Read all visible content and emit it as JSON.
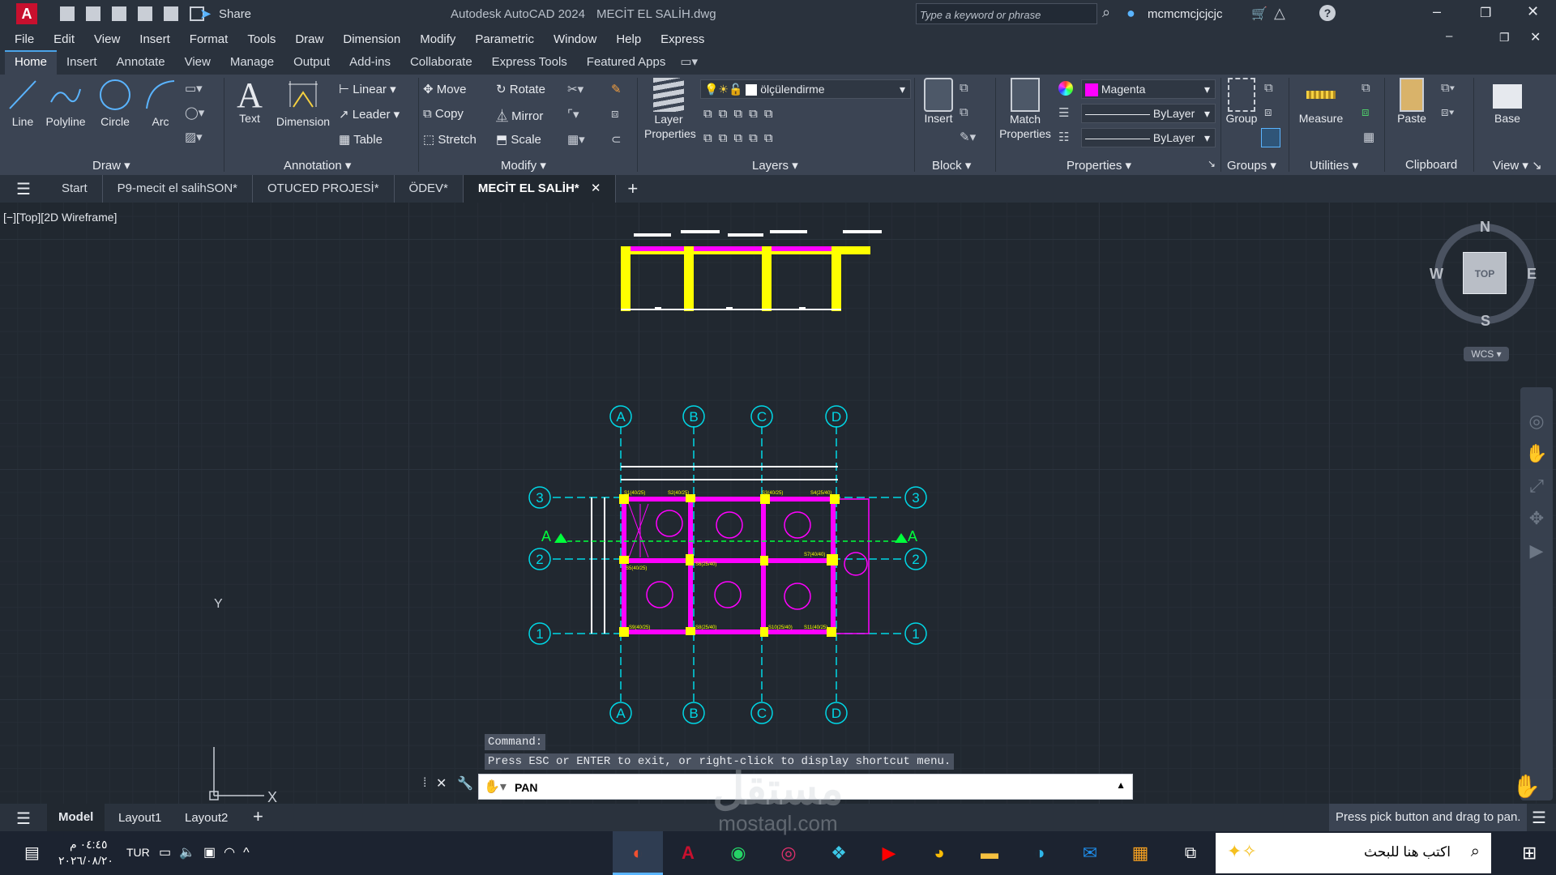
{
  "window": {
    "title": "Autodesk AutoCAD 2024",
    "file": "MECİT EL SALİH.dwg",
    "share": "Share",
    "search_placeholder": "Type a keyword or phrase",
    "user": "mcmcmcjcjcjc"
  },
  "menu": [
    "File",
    "Edit",
    "View",
    "Insert",
    "Format",
    "Tools",
    "Draw",
    "Dimension",
    "Modify",
    "Parametric",
    "Window",
    "Help",
    "Express"
  ],
  "ribbon_tabs": [
    "Home",
    "Insert",
    "Annotate",
    "View",
    "Manage",
    "Output",
    "Add-ins",
    "Collaborate",
    "Express Tools",
    "Featured Apps"
  ],
  "ribbon": {
    "draw": {
      "title": "Draw",
      "line": "Line",
      "polyline": "Polyline",
      "circle": "Circle",
      "arc": "Arc"
    },
    "annotation": {
      "title": "Annotation",
      "text": "Text",
      "dimension": "Dimension",
      "linear": "Linear",
      "leader": "Leader",
      "table": "Table"
    },
    "modify": {
      "title": "Modify",
      "move": "Move",
      "rotate": "Rotate",
      "copy": "Copy",
      "mirror": "Mirror",
      "stretch": "Stretch",
      "scale": "Scale"
    },
    "layers": {
      "title": "Layers",
      "layer_properties": "Layer Properties",
      "current_layer": "ölçülendirme"
    },
    "block": {
      "title": "Block",
      "insert": "Insert"
    },
    "properties": {
      "title": "Properties",
      "match": "Match Properties",
      "color": "Magenta",
      "linetype": "ByLayer",
      "lineweight": "ByLayer"
    },
    "groups": {
      "title": "Groups",
      "group": "Group"
    },
    "utilities": {
      "title": "Utilities",
      "measure": "Measure"
    },
    "clipboard": {
      "title": "Clipboard",
      "paste": "Paste"
    },
    "view": {
      "title": "View",
      "base": "Base"
    }
  },
  "doc_tabs": [
    "Start",
    "P9-mecit el salihSON*",
    "OTUCED PROJESİ*",
    "ÖDEV*",
    "MECİT EL SALİH*"
  ],
  "viewport": {
    "label": "[−][Top][2D Wireframe]",
    "compass": {
      "n": "N",
      "s": "S",
      "e": "E",
      "w": "W",
      "top": "TOP",
      "wcs": "WCS"
    },
    "ucs_y": "Y",
    "ucs_x": "X"
  },
  "drawing": {
    "grid_top": [
      "A",
      "B",
      "C",
      "D"
    ],
    "grid_bottom": [
      "A",
      "B",
      "C",
      "D"
    ],
    "grid_rows": [
      "3",
      "2",
      "1"
    ],
    "section": "A",
    "col_labels": [
      "S1(40/25)",
      "S2(40/25)",
      "S3(40/25)",
      "S4(25/40)",
      "S5(40/25)",
      "S6(25/40)",
      "S7(40/40)",
      "S8(25/40)",
      "S9(40/25)",
      "S10(25/40)",
      "S11(40/25)"
    ]
  },
  "command": {
    "history1": "Command:",
    "history2": "Press ESC or ENTER to exit, or right-click to display shortcut menu.",
    "current": "PAN"
  },
  "status": {
    "tabs": [
      "Model",
      "Layout1",
      "Layout2"
    ],
    "hint": "Press pick button and drag to pan."
  },
  "taskbar": {
    "lang": "TUR",
    "time": "٠٤:٤٥ م",
    "date": "٢٠٢٦/٠٨/٢٠",
    "search": "اكتب هنا للبحث"
  },
  "watermark": {
    "main": "مستقل",
    "sub": "mostaql.com"
  },
  "colors": {
    "panel": "#3b4453",
    "bar": "#2a323d",
    "canvas": "#212830",
    "magenta": "#ff00ff",
    "yellow": "#ffff00",
    "cyan": "#00d7e6",
    "green": "#00ff3c"
  }
}
